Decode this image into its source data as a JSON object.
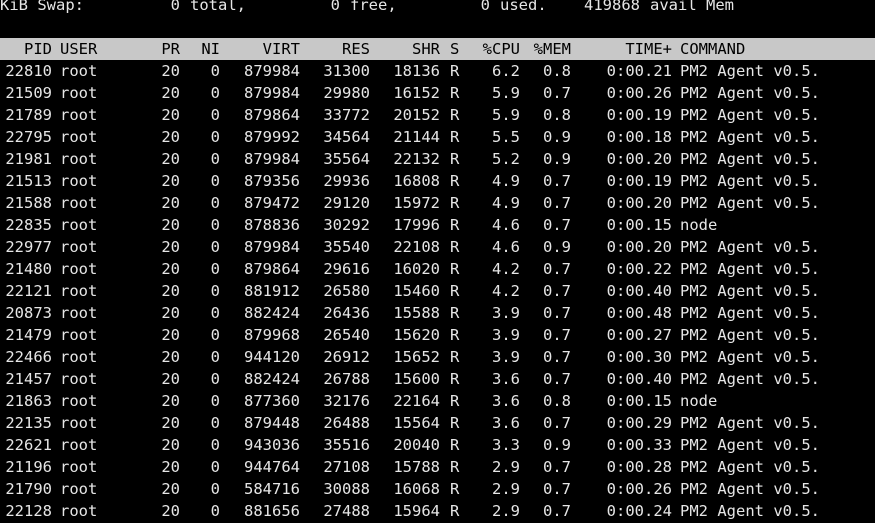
{
  "swap": {
    "label": "KiB Swap:",
    "total_value": "0",
    "total_label": "total,",
    "free_value": "0",
    "free_label": "free,",
    "used_value": "0",
    "used_label": "used.",
    "avail_value": "419868",
    "avail_label": "avail Mem"
  },
  "columns": {
    "pid": "PID",
    "user": "USER",
    "pr": "PR",
    "ni": "NI",
    "virt": "VIRT",
    "res": "RES",
    "shr": "SHR",
    "s": "S",
    "cpu": "%CPU",
    "mem": "%MEM",
    "time": "TIME+",
    "command": "COMMAND"
  },
  "colors": {
    "background": "#000000",
    "text": "#e6e6e6",
    "header_background": "#c8c8c8",
    "header_text": "#000000"
  },
  "rows": [
    {
      "pid": "22810",
      "user": "root",
      "pr": "20",
      "ni": "0",
      "virt": "879984",
      "res": "31300",
      "shr": "18136",
      "s": "R",
      "cpu": "6.2",
      "mem": "0.8",
      "time": "0:00.21",
      "command": "PM2 Agent v0.5."
    },
    {
      "pid": "21509",
      "user": "root",
      "pr": "20",
      "ni": "0",
      "virt": "879984",
      "res": "29980",
      "shr": "16152",
      "s": "R",
      "cpu": "5.9",
      "mem": "0.7",
      "time": "0:00.26",
      "command": "PM2 Agent v0.5."
    },
    {
      "pid": "21789",
      "user": "root",
      "pr": "20",
      "ni": "0",
      "virt": "879864",
      "res": "33772",
      "shr": "20152",
      "s": "R",
      "cpu": "5.9",
      "mem": "0.8",
      "time": "0:00.19",
      "command": "PM2 Agent v0.5."
    },
    {
      "pid": "22795",
      "user": "root",
      "pr": "20",
      "ni": "0",
      "virt": "879992",
      "res": "34564",
      "shr": "21144",
      "s": "R",
      "cpu": "5.5",
      "mem": "0.9",
      "time": "0:00.18",
      "command": "PM2 Agent v0.5."
    },
    {
      "pid": "21981",
      "user": "root",
      "pr": "20",
      "ni": "0",
      "virt": "879984",
      "res": "35564",
      "shr": "22132",
      "s": "R",
      "cpu": "5.2",
      "mem": "0.9",
      "time": "0:00.20",
      "command": "PM2 Agent v0.5."
    },
    {
      "pid": "21513",
      "user": "root",
      "pr": "20",
      "ni": "0",
      "virt": "879356",
      "res": "29936",
      "shr": "16808",
      "s": "R",
      "cpu": "4.9",
      "mem": "0.7",
      "time": "0:00.19",
      "command": "PM2 Agent v0.5."
    },
    {
      "pid": "21588",
      "user": "root",
      "pr": "20",
      "ni": "0",
      "virt": "879472",
      "res": "29120",
      "shr": "15972",
      "s": "R",
      "cpu": "4.9",
      "mem": "0.7",
      "time": "0:00.20",
      "command": "PM2 Agent v0.5."
    },
    {
      "pid": "22835",
      "user": "root",
      "pr": "20",
      "ni": "0",
      "virt": "878836",
      "res": "30292",
      "shr": "17996",
      "s": "R",
      "cpu": "4.6",
      "mem": "0.7",
      "time": "0:00.15",
      "command": "node"
    },
    {
      "pid": "22977",
      "user": "root",
      "pr": "20",
      "ni": "0",
      "virt": "879984",
      "res": "35540",
      "shr": "22108",
      "s": "R",
      "cpu": "4.6",
      "mem": "0.9",
      "time": "0:00.20",
      "command": "PM2 Agent v0.5."
    },
    {
      "pid": "21480",
      "user": "root",
      "pr": "20",
      "ni": "0",
      "virt": "879864",
      "res": "29616",
      "shr": "16020",
      "s": "R",
      "cpu": "4.2",
      "mem": "0.7",
      "time": "0:00.22",
      "command": "PM2 Agent v0.5."
    },
    {
      "pid": "22121",
      "user": "root",
      "pr": "20",
      "ni": "0",
      "virt": "881912",
      "res": "26580",
      "shr": "15460",
      "s": "R",
      "cpu": "4.2",
      "mem": "0.7",
      "time": "0:00.40",
      "command": "PM2 Agent v0.5."
    },
    {
      "pid": "20873",
      "user": "root",
      "pr": "20",
      "ni": "0",
      "virt": "882424",
      "res": "26436",
      "shr": "15588",
      "s": "R",
      "cpu": "3.9",
      "mem": "0.7",
      "time": "0:00.48",
      "command": "PM2 Agent v0.5."
    },
    {
      "pid": "21479",
      "user": "root",
      "pr": "20",
      "ni": "0",
      "virt": "879968",
      "res": "26540",
      "shr": "15620",
      "s": "R",
      "cpu": "3.9",
      "mem": "0.7",
      "time": "0:00.27",
      "command": "PM2 Agent v0.5."
    },
    {
      "pid": "22466",
      "user": "root",
      "pr": "20",
      "ni": "0",
      "virt": "944120",
      "res": "26912",
      "shr": "15652",
      "s": "R",
      "cpu": "3.9",
      "mem": "0.7",
      "time": "0:00.30",
      "command": "PM2 Agent v0.5."
    },
    {
      "pid": "21457",
      "user": "root",
      "pr": "20",
      "ni": "0",
      "virt": "882424",
      "res": "26788",
      "shr": "15600",
      "s": "R",
      "cpu": "3.6",
      "mem": "0.7",
      "time": "0:00.40",
      "command": "PM2 Agent v0.5."
    },
    {
      "pid": "21863",
      "user": "root",
      "pr": "20",
      "ni": "0",
      "virt": "877360",
      "res": "32176",
      "shr": "22164",
      "s": "R",
      "cpu": "3.6",
      "mem": "0.8",
      "time": "0:00.15",
      "command": "node"
    },
    {
      "pid": "22135",
      "user": "root",
      "pr": "20",
      "ni": "0",
      "virt": "879448",
      "res": "26488",
      "shr": "15564",
      "s": "R",
      "cpu": "3.6",
      "mem": "0.7",
      "time": "0:00.29",
      "command": "PM2 Agent v0.5."
    },
    {
      "pid": "22621",
      "user": "root",
      "pr": "20",
      "ni": "0",
      "virt": "943036",
      "res": "35516",
      "shr": "20040",
      "s": "R",
      "cpu": "3.3",
      "mem": "0.9",
      "time": "0:00.33",
      "command": "PM2 Agent v0.5."
    },
    {
      "pid": "21196",
      "user": "root",
      "pr": "20",
      "ni": "0",
      "virt": "944764",
      "res": "27108",
      "shr": "15788",
      "s": "R",
      "cpu": "2.9",
      "mem": "0.7",
      "time": "0:00.28",
      "command": "PM2 Agent v0.5."
    },
    {
      "pid": "21790",
      "user": "root",
      "pr": "20",
      "ni": "0",
      "virt": "584716",
      "res": "30088",
      "shr": "16068",
      "s": "R",
      "cpu": "2.9",
      "mem": "0.7",
      "time": "0:00.26",
      "command": "PM2 Agent v0.5."
    },
    {
      "pid": "22128",
      "user": "root",
      "pr": "20",
      "ni": "0",
      "virt": "881656",
      "res": "27488",
      "shr": "15964",
      "s": "R",
      "cpu": "2.9",
      "mem": "0.7",
      "time": "0:00.24",
      "command": "PM2 Agent v0.5."
    }
  ]
}
